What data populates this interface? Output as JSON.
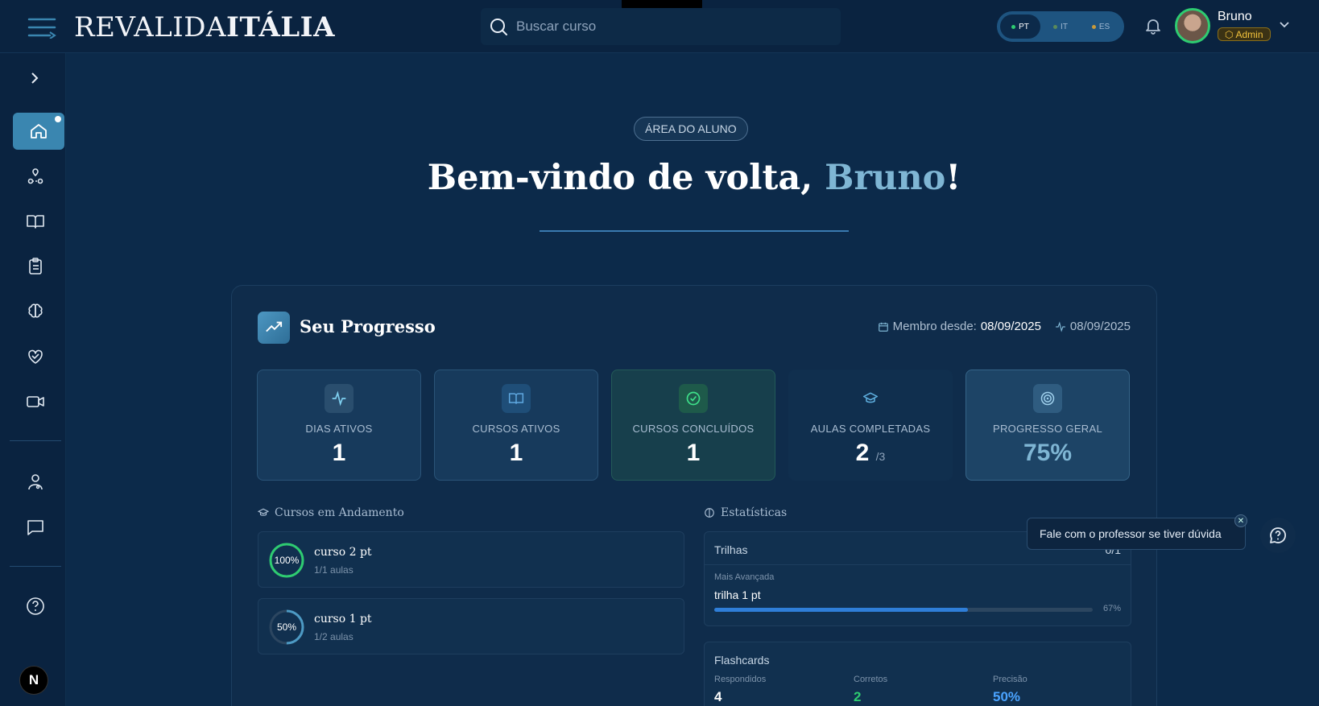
{
  "header": {
    "logo_light": "REVALIDA",
    "logo_bold": "ITÁLIA",
    "search_placeholder": "Buscar curso",
    "languages": [
      "PT",
      "IT",
      "ES"
    ],
    "active_language": "PT",
    "user_name": "Bruno",
    "user_role": "Admin"
  },
  "hero": {
    "badge": "ÁREA DO ALUNO",
    "greeting": "Bem-vindo de volta, ",
    "name": "Bruno",
    "exclaim": "!"
  },
  "progress": {
    "title": "Seu Progresso",
    "member_label": "Membro desde:",
    "member_date": "08/09/2025",
    "last_activity": "08/09/2025",
    "stats": [
      {
        "label": "DIAS ATIVOS",
        "value": "1",
        "icon": "activity-icon"
      },
      {
        "label": "CURSOS ATIVOS",
        "value": "1",
        "icon": "book-icon"
      },
      {
        "label": "CURSOS CONCLUÍDOS",
        "value": "1",
        "icon": "check-circle-icon"
      },
      {
        "label": "AULAS COMPLETADAS",
        "value": "2",
        "suffix": "/3",
        "icon": "graduation-cap-icon"
      },
      {
        "label": "PROGRESSO GERAL",
        "value": "75%",
        "icon": "target-icon"
      }
    ]
  },
  "courses": {
    "title": "Cursos em Andamento",
    "items": [
      {
        "name": "curso 2 pt",
        "lessons": "1/1 aulas",
        "percent_label": "100%",
        "percent": 1.0
      },
      {
        "name": "curso 1 pt",
        "lessons": "1/2 aulas",
        "percent_label": "50%",
        "percent": 0.5
      }
    ]
  },
  "statistics": {
    "title": "Estatísticas",
    "trilhas_label": "Trilhas",
    "trilhas_value": "0/1",
    "most_advanced_label": "Mais Avançada",
    "most_advanced_name": "trilha 1 pt",
    "most_advanced_percent_label": "67%",
    "most_advanced_percent": 0.67,
    "flashcards_label": "Flashcards",
    "answered_label": "Respondidos",
    "answered_value": "4",
    "correct_label": "Corretos",
    "correct_value": "2",
    "precision_label": "Precisão",
    "precision_value": "50%"
  },
  "chat": {
    "tooltip": "Fale com o professor se tiver dúvida",
    "close": "✕"
  },
  "sidebar": {
    "logo_letter": "N"
  },
  "colors": {
    "accent": "#7fb6d4",
    "success": "#2ecc71",
    "admin": "#f2c23c",
    "bar": "#2f7ed8"
  }
}
